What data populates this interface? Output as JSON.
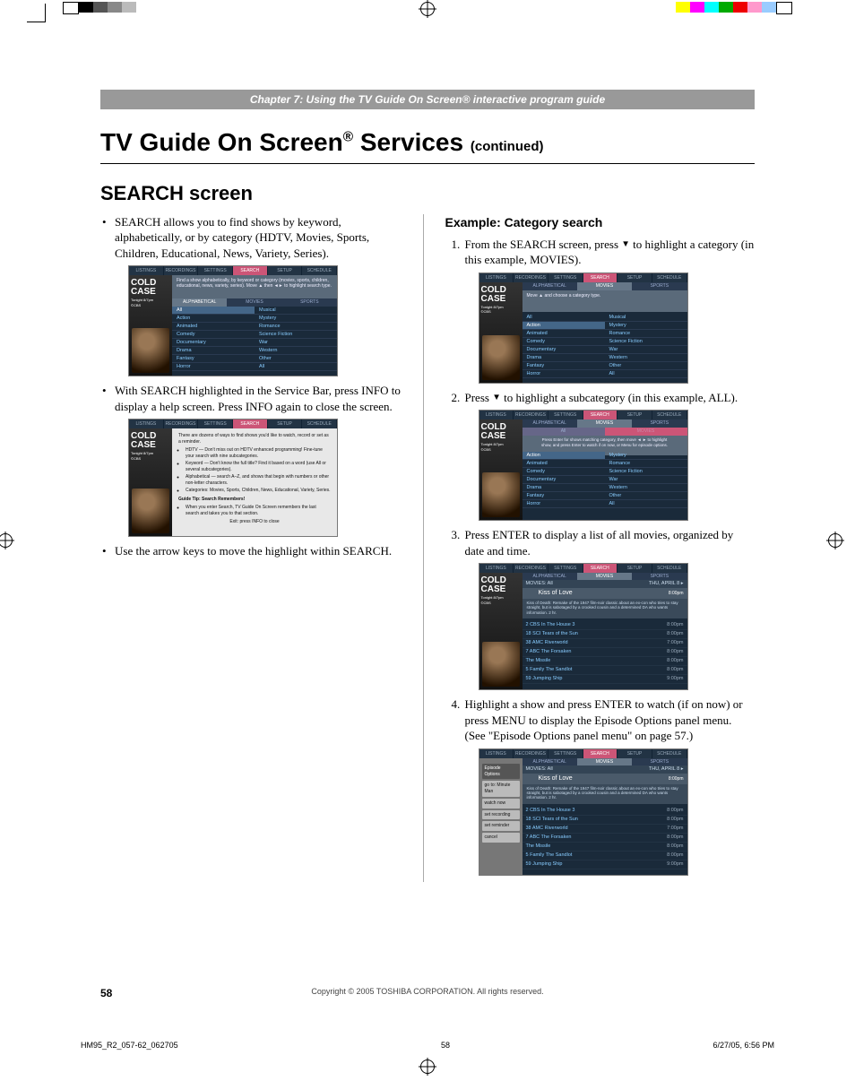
{
  "chapter_line": "Chapter 7: Using the TV Guide On Screen® interactive program guide",
  "page_title_main": "TV Guide On Screen",
  "page_title_services": " Services ",
  "page_title_cont": "(continued)",
  "section_heading": "SEARCH screen",
  "left_bullet_1": "SEARCH allows you to find shows by keyword, alphabetically, or by category (HDTV, Movies, Sports, Children, Educational, News, Variety, Series).",
  "left_bullet_2": "With SEARCH highlighted in the Service Bar, press INFO to display a help screen. Press INFO again to close the screen.",
  "left_bullet_3": "Use the arrow keys to move the highlight within SEARCH.",
  "right_heading": "Example: Category search",
  "right_step_1a": "From the SEARCH screen, press ",
  "right_step_1b": " to highlight a category (in this example, MOVIES).",
  "right_step_2a": "Press ",
  "right_step_2b": " to highlight a subcategory (in this example, ALL).",
  "right_step_3": "Press ENTER to display a list of all movies, organized by date and time.",
  "right_step_4": "Highlight a show and press ENTER to watch (if on now) or press MENU to display the Episode Options panel menu. (See \"Episode Options panel menu\" on page 57.)",
  "tabs": [
    "LISTINGS",
    "RECORDINGS",
    "SETTINGS",
    "SEARCH",
    "SETUP",
    "SCHEDULE"
  ],
  "second_tabs": [
    "ALPHABETICAL",
    "MOVIES",
    "SPORTS"
  ],
  "info_box_1": "Find a show alphabetically, by keyword or category (movies, sports, children, educational, news, variety, series). Move ▲ then ◄► to highlight search type.",
  "info_box_2": "Move ▲ and choose a category type.",
  "info_box_3": "Press Enter for shows matching category, then move ◄ ► to highlight show, and press Enter to watch if on now, or Menu for episode options.",
  "side_show_line1": "COLD",
  "side_show_line2": "CASE",
  "side_show_sub": "Tonight 8/7pm",
  "side_show_net": "©CBS",
  "categories_left": [
    "All",
    "Action",
    "Animated",
    "Comedy",
    "Documentary",
    "Drama",
    "Fantasy",
    "Horror"
  ],
  "categories_right": [
    "Musical",
    "Mystery",
    "Romance",
    "Science Fiction",
    "War",
    "Western",
    "Other",
    "All"
  ],
  "cat_hl_2": "All",
  "help_intro": "There are dozens of ways to find shows you'd like to watch, record or set as a reminder.",
  "help_bullets": [
    "HDTV — Don't miss out on HDTV enhanced programming! Fine-tune your search with nine subcategories.",
    "Keyword — Don't know the full title? Find it based on a word (use All or several subcategories).",
    "Alphabetical — search A–Z, and shows that begin with numbers or other non-letter characters.",
    "Categories: Movies, Sports, Children, News, Educational, Variety, Series."
  ],
  "help_tip_title": "Guide Tip: Search Remembers!",
  "help_tip_body": "When you enter Search, TV Guide On Screen remembers the last search and takes you to that section.",
  "help_footer": "Exit: press INFO to close",
  "results_header_left": "MOVIES: All",
  "results_header_right": "THU, APRIL 8 ▸",
  "results_title": "Kiss of Love",
  "results_time": "8:00pm",
  "results_desc": "Kiss of Death: Remake of the 1947 film-noir classic about an ex-con who tries to stay straight, but is sabotaged by a crooked cousin and a determined DA who wants information. 2 hr.",
  "result_rows": [
    {
      "ch": "2 CBS",
      "title": "In The House 3",
      "time": "8:00pm"
    },
    {
      "ch": "18 SCI",
      "title": "Tears of the Sun",
      "time": "8:00pm"
    },
    {
      "ch": "38 AMC",
      "title": "Riverworld",
      "time": "7:00pm"
    },
    {
      "ch": "7 ABC",
      "title": "The Forsaken",
      "time": "8:00pm"
    },
    {
      "ch": "",
      "title": "The Missile",
      "time": "8:00pm"
    },
    {
      "ch": "5 Family",
      "title": "The Sandlot",
      "time": "8:00pm"
    },
    {
      "ch": "59",
      "title": "Jumping Ship",
      "time": "9:00pm"
    }
  ],
  "options_panel": [
    "Episode Options",
    "go to: Minute Man",
    "watch now",
    "set recording",
    "set reminder",
    "cancel"
  ],
  "page_number": "58",
  "copyright": "Copyright © 2005 TOSHIBA CORPORATION. All rights reserved.",
  "slug_left": "HM95_R2_057-62_062705",
  "slug_mid": "58",
  "slug_right": "6/27/05, 6:56 PM"
}
